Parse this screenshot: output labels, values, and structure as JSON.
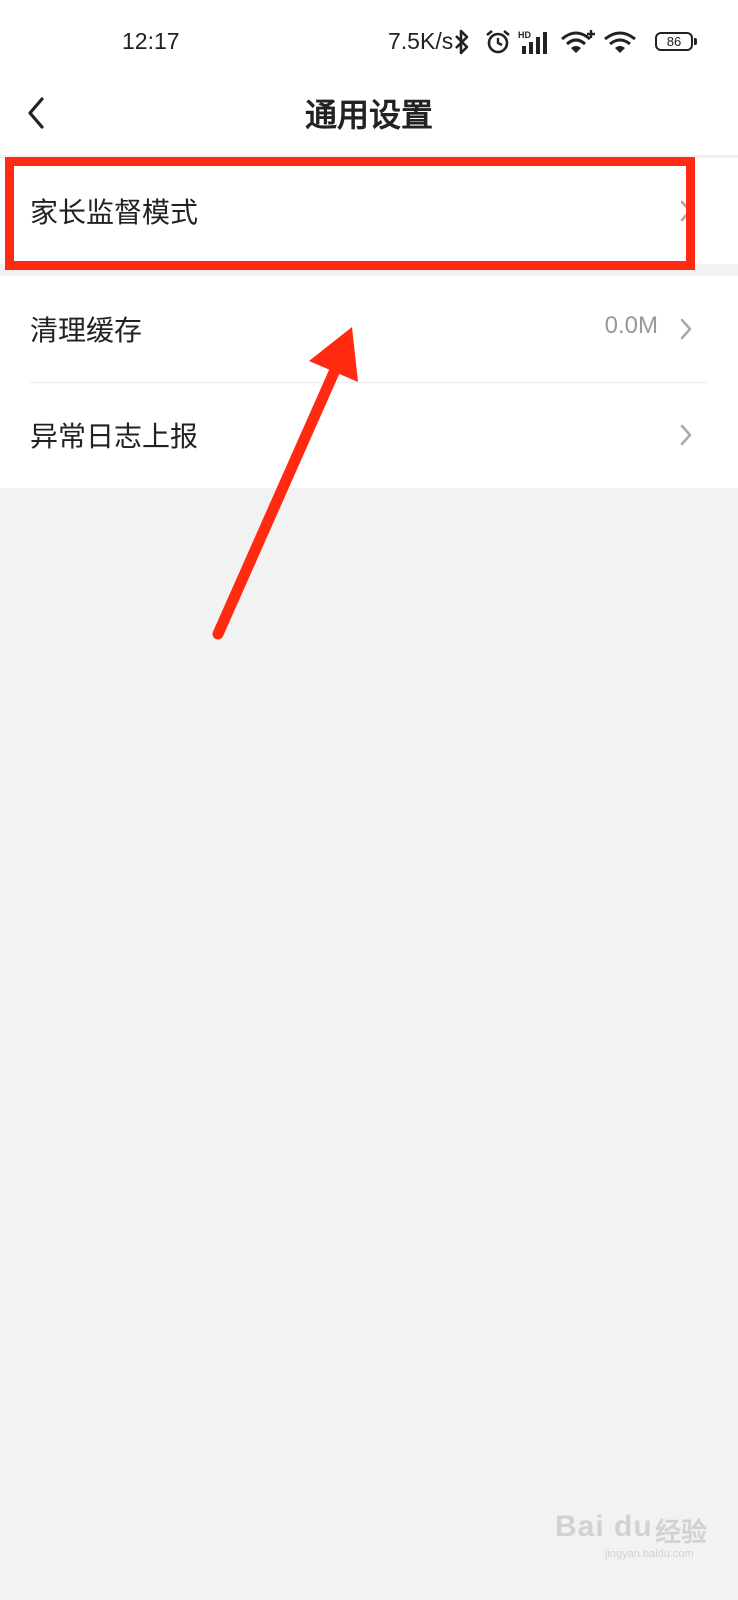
{
  "status_bar": {
    "time": "12:17",
    "net_speed": "7.5K/s",
    "battery": "86",
    "icons": [
      "bluetooth-icon",
      "alarm-icon",
      "hd-signal-icon",
      "wifi-plus-icon",
      "wifi-icon",
      "battery-icon"
    ]
  },
  "nav": {
    "title": "通用设置",
    "back_icon": "chevron-left-icon"
  },
  "settings": {
    "parent_mode": {
      "label": "家长监督模式"
    },
    "clear_cache": {
      "label": "清理缓存",
      "value": "0.0M"
    },
    "log_report": {
      "label": "异常日志上报"
    }
  },
  "annotation": {
    "box_color": "#ff2a0f",
    "arrow_color": "#ff2a0f"
  },
  "watermark": {
    "logo": "Bai du",
    "brand": "经验",
    "url": "jingyan.baidu.com"
  },
  "colors": {
    "background": "#f2f2f2",
    "surface": "#ffffff",
    "text": "#222222",
    "secondary_text": "#999999"
  }
}
